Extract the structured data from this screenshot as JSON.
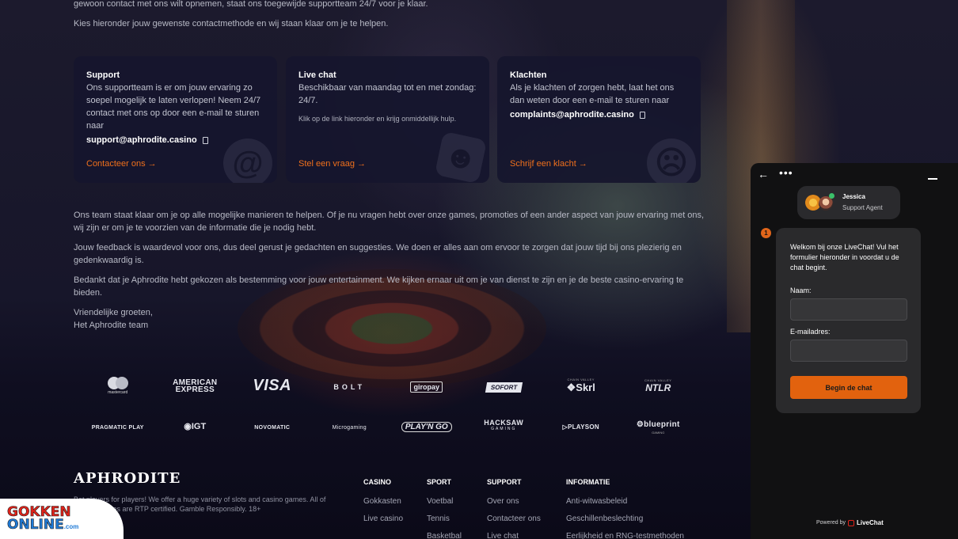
{
  "intro": {
    "line1": "gewoon contact met ons wilt opnemen, staat ons toegewijde supportteam 24/7 voor je klaar.",
    "line2": "Kies hieronder jouw gewenste contactmethode en wij staan klaar om je te helpen."
  },
  "cards": [
    {
      "title": "Support",
      "desc": "Ons supportteam is er om jouw ervaring zo soepel mogelijk te laten verlopen! Neem 24/7 contact met ons op door een e-mail te sturen naar",
      "email": "support@aphrodite.casino",
      "small": "",
      "link": "Contacteer ons →",
      "icon": "at-sign-icon"
    },
    {
      "title": "Live chat",
      "desc": "Beschikbaar van maandag tot en met zondag: 24/7.",
      "email": "",
      "small": "Klik op de link hieronder en krijg onmiddellijk hulp.",
      "link": "Stel een vraag →",
      "icon": "smiley-icon"
    },
    {
      "title": "Klachten",
      "desc": "Als je klachten of zorgen hebt, laat het ons dan weten door een e-mail te sturen naar",
      "email": "complaints@aphrodite.casino",
      "small": "",
      "link": "Schrijf een klacht →",
      "icon": "sad-face-icon"
    }
  ],
  "body": {
    "p1": "Ons team staat klaar om je op alle mogelijke manieren te helpen. Of je nu vragen hebt over onze games, promoties of een ander aspect van jouw ervaring met ons, wij zijn er om je te voorzien van de informatie die je nodig hebt.",
    "p2": "Jouw feedback is waardevol voor ons, dus deel gerust je gedachten en suggesties. We doen er alles aan om ervoor te zorgen dat jouw tijd bij ons plezierig en gedenkwaardig is.",
    "p3": "Bedankt dat je Aphrodite hebt gekozen als bestemming voor jouw entertainment. We kijken ernaar uit om je van dienst te zijn en je de beste casino-ervaring te bieden.",
    "sign1": "Vriendelijke groeten,",
    "sign2": "Het Aphrodite team"
  },
  "payments": {
    "mastercard": "mastercard",
    "amex_1": "AMERICAN",
    "amex_2": "EXPRESS",
    "visa": "VISA",
    "bolt": "BOLT",
    "giropay": "giropay",
    "sofort": "SOFORT",
    "skrill_top": "CHAIN VALLEY",
    "skrill": "Skrl",
    "ntlr_top": "CHAIN VALLEY",
    "ntlr": "NTLR"
  },
  "providers": {
    "pragmatic": "PRAGMATIC PLAY",
    "igt": "IGT",
    "novomatic": "NOVOMATIC",
    "microgaming": "Microgaming",
    "playngo": "PLAY'N GO",
    "hacksaw_1": "HACKSAW",
    "hacksaw_2": "GAMING",
    "playson": "PLAYSON",
    "blueprint": "blueprint",
    "blueprint_sub": "GAMING"
  },
  "footer": {
    "brand": "APHRODITE",
    "text": "Bet players for players! We offer a huge variety of slots and casino games. All of our slot games are RTP certified. Gamble Responsibly. 18+",
    "columns": [
      {
        "title": "CASINO",
        "links": [
          "Gokkasten",
          "Live casino"
        ]
      },
      {
        "title": "SPORT",
        "links": [
          "Voetbal",
          "Tennis",
          "Basketbal"
        ]
      },
      {
        "title": "SUPPORT",
        "links": [
          "Over ons",
          "Contacteer ons",
          "Live chat"
        ]
      },
      {
        "title": "INFORMATIE",
        "links": [
          "Anti-witwasbeleid",
          "Geschillenbeslechting",
          "Eerlijkheid en RNG-testmethoden"
        ]
      }
    ]
  },
  "watermark": {
    "part1": "GOKKEN",
    "part2": "ONLINE",
    "part3": ".com"
  },
  "chat": {
    "agent_name": "Jessica",
    "agent_role": "Support Agent",
    "badge": "1",
    "message": "Welkom bij onze LiveChat! Vul het formulier hieronder in voordat u de chat begint.",
    "name_label": "Naam:",
    "email_label": "E-mailadres:",
    "name_value": "",
    "email_value": "",
    "start_button": "Begin de chat",
    "powered_by": "Powered by",
    "powered_brand": "LiveChat",
    "accent": "#e2620e"
  }
}
